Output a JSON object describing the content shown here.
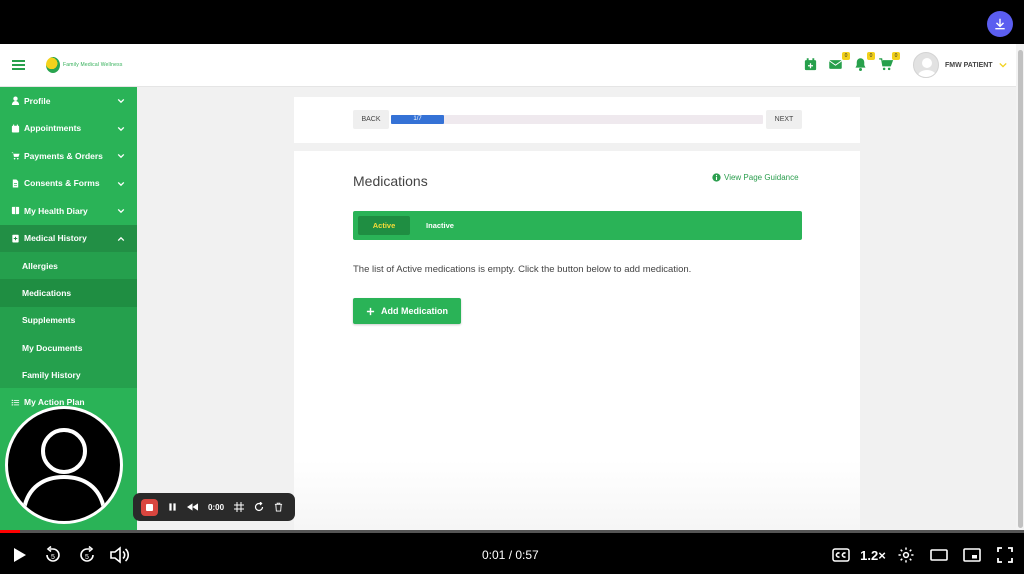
{
  "topbar": {
    "logo_text": "Family Medical Wellness",
    "badges": {
      "calendar": "",
      "mail": "0",
      "bell": "0",
      "cart": "0"
    },
    "user_name": "FMW PATIENT"
  },
  "sidebar": {
    "items": [
      {
        "label": "Profile"
      },
      {
        "label": "Appointments"
      },
      {
        "label": "Payments & Orders"
      },
      {
        "label": "Consents & Forms"
      },
      {
        "label": "My Health Diary"
      },
      {
        "label": "Medical History"
      },
      {
        "label": "My Action Plan"
      }
    ],
    "sub_items": [
      {
        "label": "Allergies"
      },
      {
        "label": "Medications"
      },
      {
        "label": "Supplements"
      },
      {
        "label": "My Documents"
      },
      {
        "label": "Family History"
      }
    ]
  },
  "wizard": {
    "back_label": "BACK",
    "next_label": "NEXT",
    "progress_label": "1/7",
    "progress_fraction": 0.1428
  },
  "main": {
    "title": "Medications",
    "guidance_label": "View Page Guidance",
    "tabs": [
      {
        "label": "Active"
      },
      {
        "label": "Inactive"
      }
    ],
    "empty_message": "The list of Active medications is empty. Click the button below to add medication.",
    "add_button_label": "Add Medication"
  },
  "recorder": {
    "time": "0:00"
  },
  "player": {
    "time": "0:01 / 0:57",
    "speed": "1.2×",
    "skip_back": "5",
    "skip_forward": "5",
    "played_fraction": 0.02
  },
  "colors": {
    "brand_green": "#2ab357",
    "dark_green": "#1f8e42",
    "accent_yellow": "#f6dc38",
    "progress_blue": "#3572d6"
  }
}
